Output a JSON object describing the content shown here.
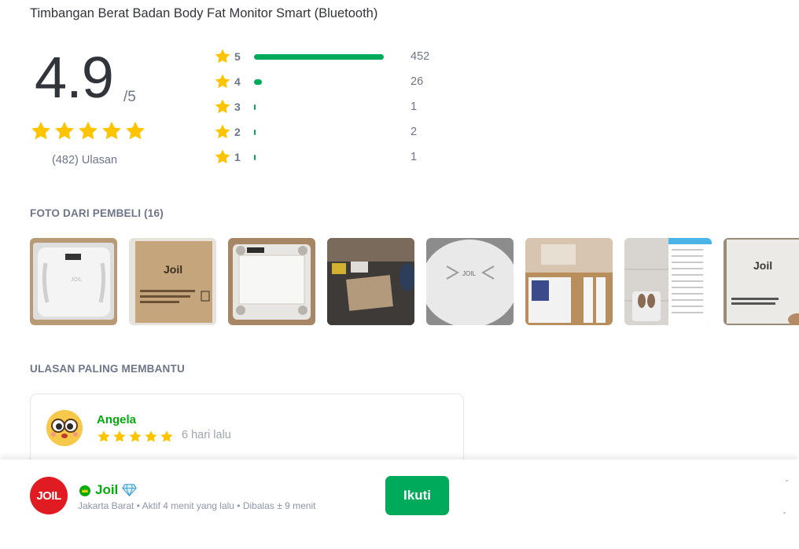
{
  "product": {
    "title": "Timbangan Berat Badan Body Fat Monitor Smart (Bluetooth)"
  },
  "rating": {
    "average": "4.9",
    "out_of": "/5",
    "stars": 5,
    "review_count": "(482) Ulasan",
    "distribution": [
      {
        "level": "5",
        "count": "452",
        "fraction": 0.94
      },
      {
        "level": "4",
        "count": "26",
        "fraction": 0.054
      },
      {
        "level": "3",
        "count": "1",
        "fraction": 0.002
      },
      {
        "level": "2",
        "count": "2",
        "fraction": 0.004
      },
      {
        "level": "1",
        "count": "1",
        "fraction": 0.002
      }
    ]
  },
  "photos_section": {
    "label": "FOTO DARI PEMBELI (16)",
    "photos": [
      {
        "icon": "scale-top-photo"
      },
      {
        "icon": "joil-box-photo"
      },
      {
        "icon": "scale-in-box-photo"
      },
      {
        "icon": "package-on-table-photo"
      },
      {
        "icon": "scale-closeup-photo"
      },
      {
        "icon": "unboxing-photo"
      },
      {
        "icon": "app-screenshot-photo"
      },
      {
        "icon": "joil-box-photo-2"
      }
    ]
  },
  "helpful_section": {
    "label": "ULASAN PALING MEMBANTU",
    "review": {
      "name": "Angela",
      "stars": 5,
      "time": "6 hari lalu"
    }
  },
  "shop": {
    "logo_text": "JOIL",
    "name": "Joil",
    "meta": "Jakarta Barat • Aktif 4 menit yang lalu • Dibalas ± 9 menit",
    "follow_label": "Ikuti"
  },
  "colors": {
    "accent_green": "#00aa5b",
    "name_green": "#03ac0e",
    "star_yellow": "#ffc400",
    "shop_red": "#e11b22"
  }
}
